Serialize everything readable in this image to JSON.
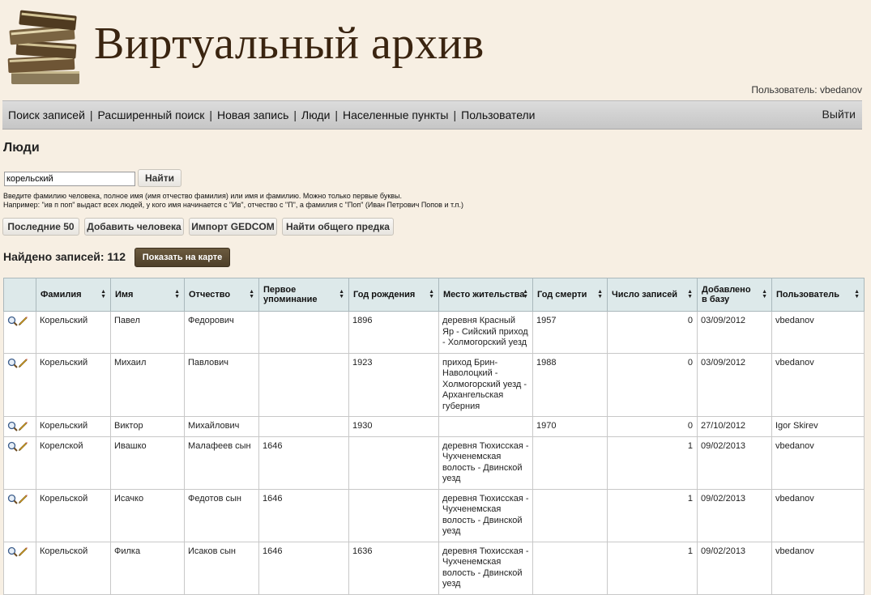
{
  "header": {
    "title": "Виртуальный архив",
    "user_label": "Пользователь: vbedanov",
    "logo_icon": "books-stack-icon"
  },
  "nav": {
    "items": [
      "Поиск записей",
      "Расширенный поиск",
      "Новая запись",
      "Люди",
      "Населенные пункты",
      "Пользователи"
    ],
    "logout": "Выйти"
  },
  "page": {
    "title": "Люди",
    "search": {
      "value": "корельский",
      "button": "Найти",
      "hint1": "Введите фамилию человека, полное имя (имя отчество фамилия) или имя и фамилию. Можно только первые буквы.",
      "hint2": "Например: \"ив п поп\" выдаст всех людей, у кого имя начинается с \"Ив\", отчество с \"П\", а фамилия с \"Поп\" (Иван Петрович Попов и т.п.)"
    },
    "buttons": {
      "last50": "Последние 50",
      "add_person": "Добавить человека",
      "import": "Импорт GEDCOM",
      "ancestor": "Найти общего предка"
    },
    "found": "Найдено записей: 112",
    "map_button": "Показать на карте"
  },
  "table": {
    "headers": [
      "Фамилия",
      "Имя",
      "Отчество",
      "Первое упоминание",
      "Год рождения",
      "Место жительства",
      "Год смерти",
      "Число записей",
      "Добавлено в базу",
      "Пользователь"
    ],
    "rows": [
      [
        "Корельский",
        "Павел",
        "Федорович",
        "",
        "1896",
        "деревня Красный Яр - Сийский приход - Холмогорский уезд",
        "1957",
        "0",
        "03/09/2012",
        "vbedanov"
      ],
      [
        "Корельский",
        "Михаил",
        "Павлович",
        "",
        "1923",
        "приход Брин-Наволоцкий - Холмогорский уезд - Архангельская губерния",
        "1988",
        "0",
        "03/09/2012",
        "vbedanov"
      ],
      [
        "Корельский",
        "Виктор",
        "Михайлович",
        "",
        "1930",
        "",
        "1970",
        "0",
        "27/10/2012",
        "Igor Skirev"
      ],
      [
        "Корелской",
        "Ивашко",
        "Малафеев сын",
        "1646",
        "",
        "деревня Тюхисская - Чухченемская волость - Двинской уезд",
        "",
        "1",
        "09/02/2013",
        "vbedanov"
      ],
      [
        "Корельской",
        "Исачко",
        "Федотов сын",
        "1646",
        "",
        "деревня Тюхисская - Чухченемская волость - Двинской уезд",
        "",
        "1",
        "09/02/2013",
        "vbedanov"
      ],
      [
        "Корельской",
        "Филка",
        "Исаков сын",
        "1646",
        "1636",
        "деревня Тюхисская - Чухченемская волость - Двинской уезд",
        "",
        "1",
        "09/02/2013",
        "vbedanov"
      ]
    ]
  },
  "icons": {
    "view": "magnifier-icon",
    "edit": "pencil-icon",
    "sort": "sort-arrows-icon"
  }
}
